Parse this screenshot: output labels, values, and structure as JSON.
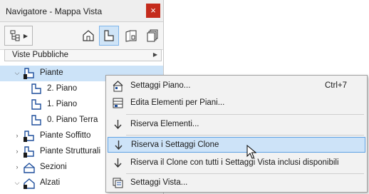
{
  "window": {
    "title": "Navigatore - Mappa Vista",
    "close_symbol": "×"
  },
  "toolbar": {
    "buttons": [
      {
        "icon": "project-map-icon"
      },
      {
        "icon": "view-map-icon",
        "selected": true
      },
      {
        "icon": "layout-book-icon"
      },
      {
        "icon": "publisher-sets-icon"
      }
    ]
  },
  "viewset": {
    "label": "Viste Pubbliche"
  },
  "tree": {
    "items": [
      {
        "label": "Piante",
        "expander": "open",
        "selected": true
      },
      {
        "label": "2. Piano"
      },
      {
        "label": "1. Piano"
      },
      {
        "label": "0. Piano Terra"
      },
      {
        "label": "Piante Soffitto",
        "expander": "closed"
      },
      {
        "label": "Piante Strutturali",
        "expander": "closed"
      },
      {
        "label": "Sezioni",
        "expander": "closed"
      },
      {
        "label": "Alzati",
        "expander": "open"
      }
    ]
  },
  "context_menu": {
    "items": [
      {
        "label": "Settaggi Piano...",
        "shortcut": "Ctrl+7",
        "icon": "story-settings-icon"
      },
      {
        "label": "Edita Elementi per Piani...",
        "icon": "edit-elements-by-story-icon"
      },
      {
        "label": "Riserva Elementi...",
        "icon": "reserve-arrow-icon"
      },
      {
        "label": "Riserva i Settaggi Clone",
        "icon": "reserve-arrow-icon",
        "highlighted": true
      },
      {
        "label": "Riserva il Clone con tutti i Settaggi Vista inclusi disponibili",
        "icon": "reserve-arrow-icon"
      },
      {
        "label": "Settaggi Vista...",
        "icon": "view-settings-icon"
      }
    ]
  },
  "colors": {
    "selection": "#cce3f8",
    "menu_highlight": "#cde3f8",
    "highlight_border": "#5ea1e4",
    "close_red": "#c42b1c"
  }
}
